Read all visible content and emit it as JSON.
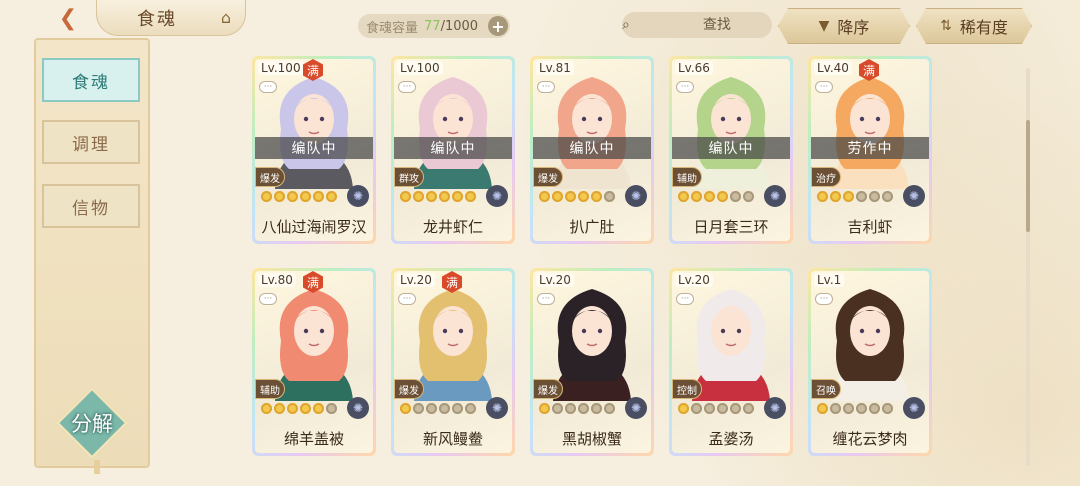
{
  "header": {
    "title": "食魂",
    "capacity_label": "食魂容量",
    "capacity_current": "77",
    "capacity_max": "/1000",
    "search_placeholder": "查找",
    "sort_label": "降序",
    "filter_label": "稀有度"
  },
  "sidebar": {
    "tabs": [
      {
        "label": "食魂",
        "active": true
      },
      {
        "label": "调理",
        "active": false
      },
      {
        "label": "信物",
        "active": false
      }
    ],
    "decompose_label": "分解"
  },
  "cards": [
    {
      "level": "Lv.100",
      "maxed": true,
      "status": "编队中",
      "role": "爆发",
      "stars_on": 6,
      "stars_total": 6,
      "name": "八仙过海闹罗汉",
      "hair": "#c9c6ea",
      "outfit": "#5a5a60"
    },
    {
      "level": "Lv.100",
      "maxed": false,
      "status": "编队中",
      "role": "群攻",
      "stars_on": 6,
      "stars_total": 6,
      "name": "龙井虾仁",
      "hair": "#eac9d4",
      "outfit": "#3a7a70"
    },
    {
      "level": "Lv.81",
      "maxed": false,
      "status": "编队中",
      "role": "爆发",
      "stars_on": 5,
      "stars_total": 6,
      "name": "扒广肚",
      "hair": "#f1a58a",
      "outfit": "#efe4d0"
    },
    {
      "level": "Lv.66",
      "maxed": false,
      "status": "编队中",
      "role": "辅助",
      "stars_on": 4,
      "stars_total": 6,
      "name": "日月套三环",
      "hair": "#b3d48a",
      "outfit": "#eef0dc"
    },
    {
      "level": "Lv.40",
      "maxed": true,
      "status": "劳作中",
      "role": "治疗",
      "stars_on": 3,
      "stars_total": 6,
      "name": "吉利虾",
      "hair": "#f5a860",
      "outfit": "#fbe0c0"
    },
    {
      "level": "Lv.80",
      "maxed": true,
      "status": "",
      "role": "辅助",
      "stars_on": 5,
      "stars_total": 6,
      "name": "绵羊盖被",
      "hair": "#f08a70",
      "outfit": "#2e7060"
    },
    {
      "level": "Lv.20",
      "maxed": true,
      "status": "",
      "role": "爆发",
      "stars_on": 1,
      "stars_total": 6,
      "name": "新风鳗鲞",
      "hair": "#e3c070",
      "outfit": "#6a9ac0"
    },
    {
      "level": "Lv.20",
      "maxed": false,
      "status": "",
      "role": "爆发",
      "stars_on": 1,
      "stars_total": 6,
      "name": "黑胡椒蟹",
      "hair": "#2a2226",
      "outfit": "#3a2020"
    },
    {
      "level": "Lv.20",
      "maxed": false,
      "status": "",
      "role": "控制",
      "stars_on": 1,
      "stars_total": 6,
      "name": "孟婆汤",
      "hair": "#f0eaea",
      "outfit": "#c83040"
    },
    {
      "level": "Lv.1",
      "maxed": false,
      "status": "",
      "role": "召唤",
      "stars_on": 1,
      "stars_total": 6,
      "name": "缠花云梦肉",
      "hair": "#4a3020",
      "outfit": "#f4efe6"
    }
  ],
  "colors": {
    "accent_teal": "#7bb8aa",
    "badge_red": "#d94a2a",
    "star_gold": "#f2c94c"
  }
}
